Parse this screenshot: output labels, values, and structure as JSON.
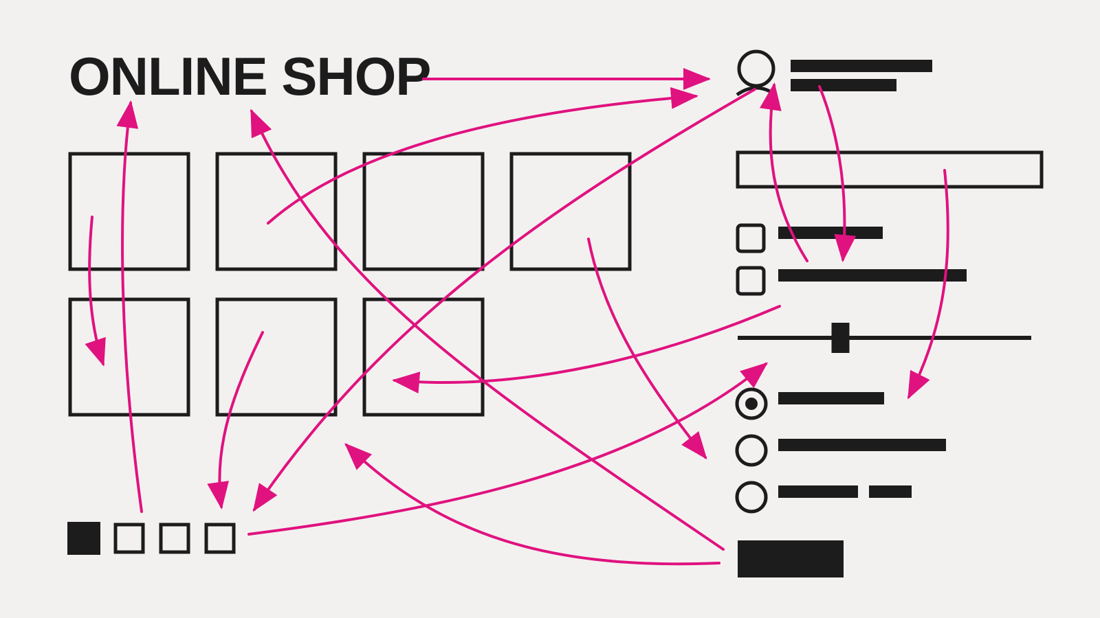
{
  "title": "ONLINE SHOP",
  "colors": {
    "background": "#f3f1f0",
    "ink": "#1c1c1c",
    "arrow": "#e0127f"
  },
  "icons": {
    "user": "user-icon",
    "checkbox": "checkbox-icon",
    "radio": "radio-icon"
  },
  "filters": {
    "checkboxes": [
      false,
      false
    ],
    "radios_selected_index": 0,
    "radio_count": 3,
    "price_slider_level": 0.35
  },
  "pagination": {
    "page_count": 4,
    "current_page": 1
  },
  "product_grid": {
    "rows": 2,
    "tiles": 7
  }
}
